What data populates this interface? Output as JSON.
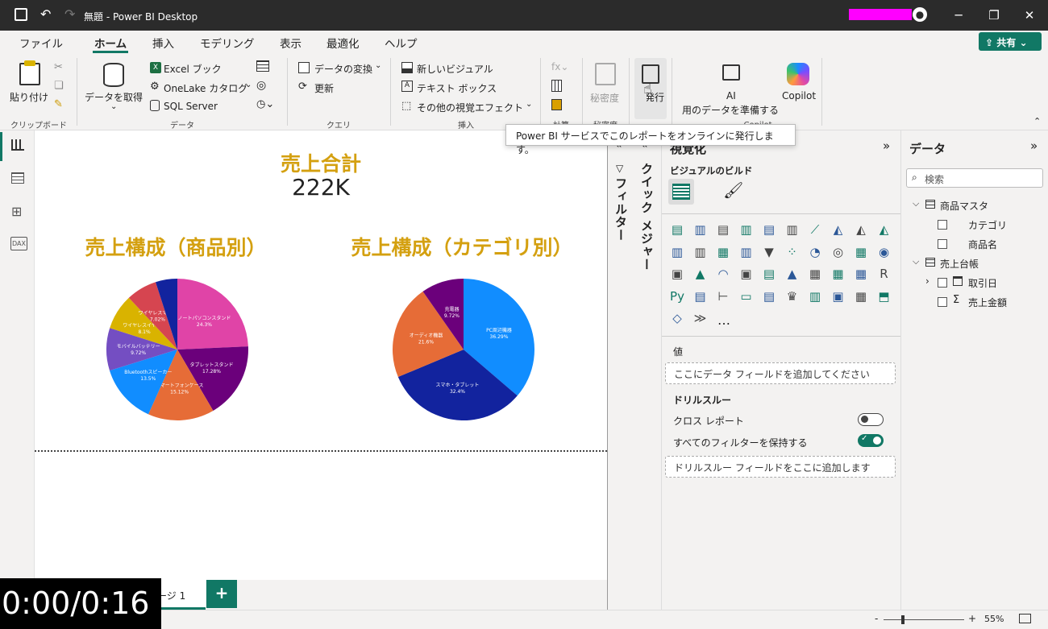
{
  "window": {
    "title": "無題 - Power BI Desktop"
  },
  "menu": {
    "file": "ファイル",
    "home": "ホーム",
    "insert": "挿入",
    "modeling": "モデリング",
    "view": "表示",
    "optimize": "最適化",
    "help": "ヘルプ",
    "share": "共有"
  },
  "ribbon": {
    "paste": "貼り付け",
    "clipboard_group": "クリップボード",
    "get_data": "データを取得",
    "excel": "Excel ブック",
    "onelake": "OneLake カタログ",
    "sql": "SQL Server",
    "data_group": "データ",
    "transform": "データの変換",
    "refresh": "更新",
    "query_group": "クエリ",
    "new_visual": "新しいビジュアル",
    "textbox": "テキスト ボックス",
    "more_visuals": "その他の視覚エフェクト",
    "insert_group": "挿入",
    "calc_group": "計算",
    "sensitivity": "秘密度",
    "sensitivity_group": "秘密度",
    "publish": "発行",
    "ai_label1": "AI",
    "ai_label2": "用のデータを準備する",
    "copilot": "Copilot",
    "copilot_group": "Copilot"
  },
  "tooltip": "Power BI サービスでこのレポートをオンラインに発行します。",
  "report": {
    "card_title": "売上合計",
    "card_value": "222K",
    "chart1_title": "売上構成（商品別）",
    "chart2_title": "売上構成（カテゴリ別）"
  },
  "chart_data": [
    {
      "type": "pie",
      "title": "売上構成（商品別）",
      "categories": [
        "ノートパソコンスタンド",
        "タブレットスタンド",
        "スマートフォンケース",
        "Bluetoothスピーカー",
        "モバイルバッテリー",
        "ワイヤレスイヤホン",
        "ワイヤレスマウス"
      ],
      "values": [
        24.3,
        17.28,
        15.12,
        13.5,
        9.72,
        8.1,
        7.02
      ],
      "labels": [
        "24.3%",
        "17.28%",
        "15.12%",
        "13.5%",
        "9.72%",
        "8.1%",
        "7.02%"
      ],
      "colors": [
        "#e044a7",
        "#6b007b",
        "#e66c37",
        "#118dff",
        "#744ec2",
        "#d9b300",
        "#d64550"
      ],
      "extra_slice_color": "#12239e"
    },
    {
      "type": "pie",
      "title": "売上構成（カテゴリ別）",
      "categories": [
        "PC周辺機器",
        "スマホ・タブレット",
        "オーディオ機器",
        "充電器"
      ],
      "values": [
        36.29,
        32.4,
        21.6,
        9.72
      ],
      "labels": [
        "36.29%",
        "32.4%",
        "21.6%",
        "9.72%"
      ],
      "colors": [
        "#118dff",
        "#12239e",
        "#e66c37",
        "#6b007b"
      ]
    }
  ],
  "panes": {
    "filter": "フィルター",
    "quick_measure": "クイック メジャー",
    "visualizations": "視覚化",
    "build_visual": "ビジュアルのビルド",
    "values": "値",
    "values_placeholder": "ここにデータ フィールドを追加してください",
    "drillthrough": "ドリルスルー",
    "cross_report": "クロス レポート",
    "keep_filters": "すべてのフィルターを保持する",
    "drill_placeholder": "ドリルスルー フィールドをここに追加します",
    "data": "データ",
    "search_placeholder": "検索",
    "more": "…"
  },
  "fields": {
    "table1": "商品マスタ",
    "t1f1": "カテゴリ",
    "t1f2": "商品名",
    "table2": "売上台帳",
    "t2f1": "取引日",
    "t2f2": "売上金額"
  },
  "pages": {
    "page1": "ページ 1",
    "add": "+"
  },
  "status": {
    "zoom": "55%",
    "minus": "-",
    "plus": "+"
  },
  "timer": "0:00/0:16",
  "colors": {
    "accent": "#117865",
    "title_gold": "#d4a010",
    "magenta": "#ff00ff"
  }
}
